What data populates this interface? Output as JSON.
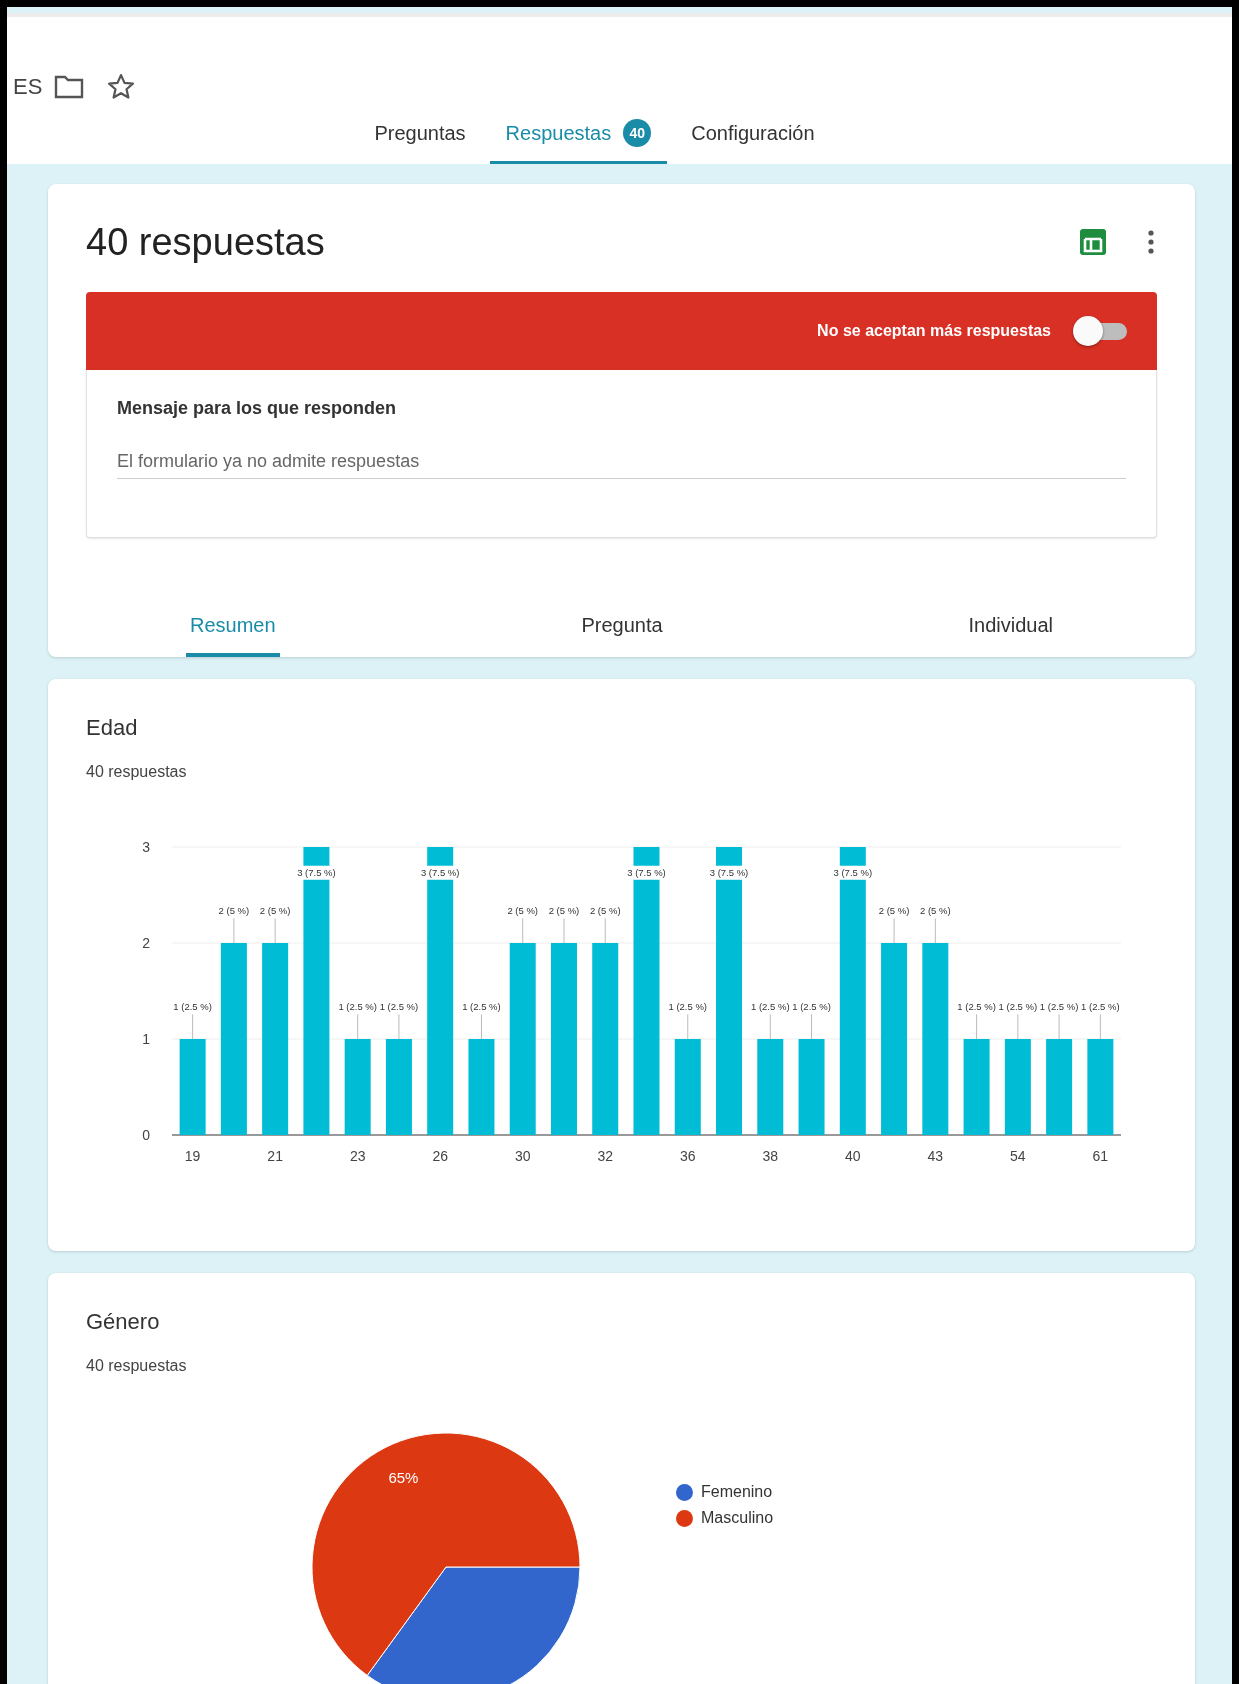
{
  "header": {
    "title_fragment": "ES"
  },
  "tabs": [
    {
      "label": "Preguntas",
      "selected": false
    },
    {
      "label": "Respuestas",
      "selected": true,
      "badge": "40"
    },
    {
      "label": "Configuración",
      "selected": false
    }
  ],
  "summary": {
    "title": "40 respuestas",
    "accepting": {
      "label": "No se aceptan más respuestas",
      "on": false
    },
    "message": {
      "label": "Mensaje para los que responden",
      "value": "El formulario ya no admite respuestas"
    }
  },
  "view_tabs": [
    {
      "label": "Resumen",
      "selected": true
    },
    {
      "label": "Pregunta",
      "selected": false
    },
    {
      "label": "Individual",
      "selected": false
    }
  ],
  "questions": [
    {
      "kind": "bar",
      "title": "Edad",
      "count": "40 respuestas",
      "chart_data": {
        "type": "bar",
        "categories": [
          "19",
          null,
          "21",
          null,
          "23",
          null,
          "26",
          null,
          "30",
          null,
          "32",
          null,
          "36",
          null,
          "38",
          null,
          "40",
          null,
          "43",
          null,
          "54",
          null,
          "61"
        ],
        "ylim": [
          0,
          3
        ],
        "yticks": [
          0,
          1,
          2,
          3
        ],
        "series": [
          {
            "color": "#00bcd4",
            "values": [
              1,
              2,
              2,
              3,
              1,
              1,
              3,
              1,
              2,
              2,
              2,
              3,
              1,
              3,
              1,
              1,
              3,
              2,
              2,
              1,
              1,
              1,
              1
            ]
          }
        ],
        "value_labels": [
          "1 (2.5 %)",
          "2 (5 %)",
          "2 (5 %)",
          "3 (7.5 %)",
          "1 (2.5 %)",
          "1 (2.5 %)",
          "3 (7.5 %)",
          "1 (2.5 %)",
          "2 (5 %)",
          "2 (5 %)",
          "2 (5 %)",
          "3 (7.5 %)",
          "1 (2.5 %)",
          "3 (7.5 %)",
          "1 (2.5 %)",
          "1 (2.5 %)",
          "3 (7.5 %)",
          "2 (5 %)",
          "2 (5 %)",
          "1 (2.5 %)",
          "1 (2.5 %)",
          "1 (2.5 %)",
          "1 (2.5 %)"
        ]
      }
    },
    {
      "kind": "pie",
      "title": "Género",
      "count": "40 respuestas",
      "chart_data": {
        "type": "pie",
        "categories": [
          "Femenino",
          "Masculino"
        ],
        "colors": [
          "#3366cc",
          "#dc3912"
        ],
        "legend": "right",
        "series": [
          {
            "values": [
              35,
              65
            ]
          }
        ],
        "value_labels": [
          null,
          "65%"
        ]
      }
    }
  ]
}
